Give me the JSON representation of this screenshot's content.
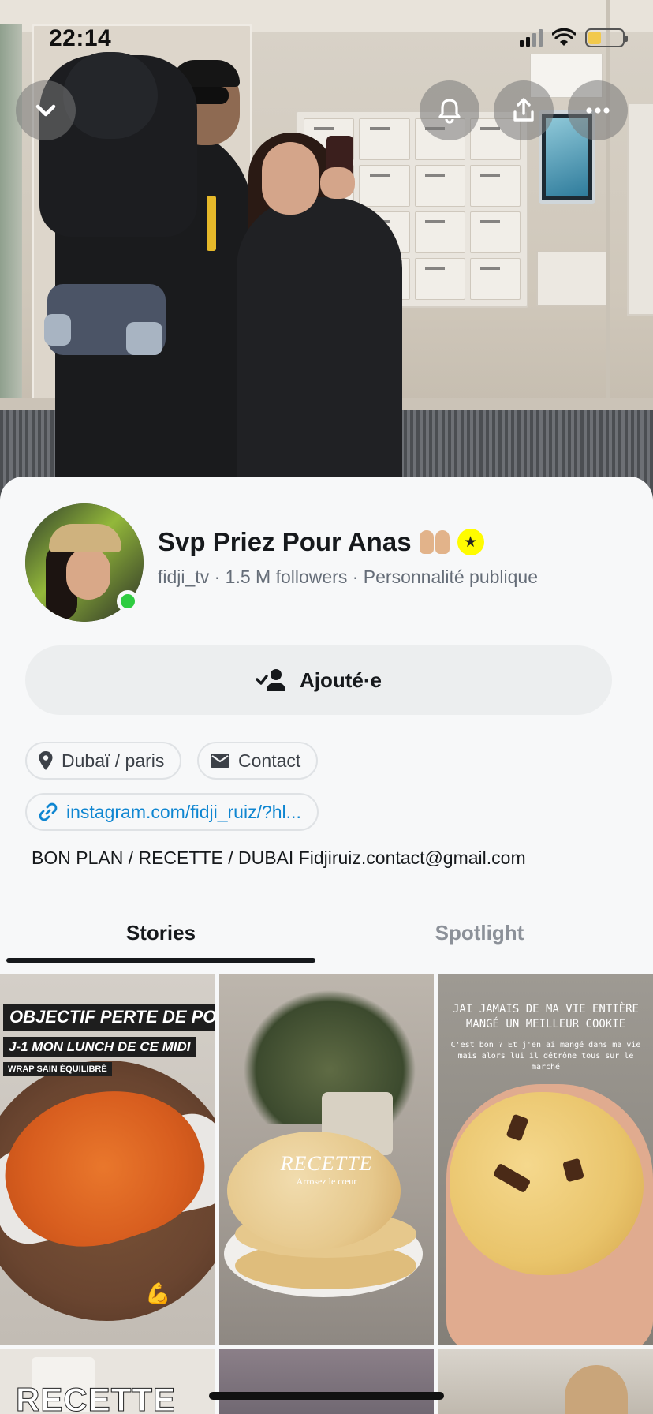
{
  "status_bar": {
    "time": "22:14"
  },
  "profile": {
    "display_name": "Svp Priez Pour Anas",
    "username": "fidji_tv",
    "separator": "·",
    "followers": "1.5 M followers",
    "category": "Personnalité publique",
    "online": true
  },
  "actions": {
    "added_label": "Ajouté·e"
  },
  "chips": {
    "location": "Dubaï / paris",
    "contact": "Contact",
    "link": "instagram.com/fidji_ruiz/?hl..."
  },
  "bio": "BON PLAN / RECETTE / DUBAI Fidjiruiz.contact@gmail.com",
  "tabs": [
    {
      "label": "Stories",
      "active": true
    },
    {
      "label": "Spotlight",
      "active": false
    }
  ],
  "stories": [
    {
      "title": "OBJECTIF PERTE DE POIDS",
      "subtitle": "J-1 MON LUNCH DE CE MIDI",
      "caption": "WRAP SAIN ÉQUILIBRÉ"
    },
    {
      "title": "RECETTE",
      "subtitle": "Arrosez le cœur"
    },
    {
      "title": "JAI JAMAIS DE MA VIE ENTIÈRE MANGÉ UN MEILLEUR COOKIE",
      "subtitle": "C'est bon ? Et j'en ai mangé dans ma vie mais alors lui il détrône tous sur le marché"
    },
    {
      "title": "RECETTE"
    },
    {
      "title": ""
    },
    {
      "title": ""
    }
  ],
  "icons": {
    "collapse": "chevron-down-icon",
    "notifications": "bell-icon",
    "share": "share-icon",
    "more": "more-icon",
    "added": "user-check-icon",
    "location": "location-pin-icon",
    "contact": "mail-icon",
    "link": "link-icon",
    "badge": "star-badge-icon"
  },
  "colors": {
    "accent_link": "#0f86d1",
    "online": "#2ecc40",
    "badge": "#fffc00"
  }
}
